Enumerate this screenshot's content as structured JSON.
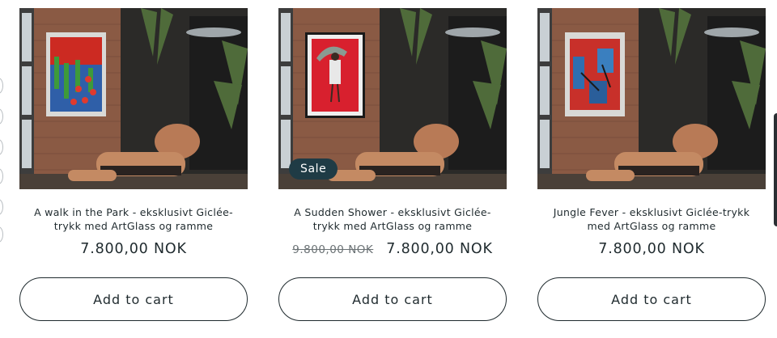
{
  "products": [
    {
      "title": "A walk in the Park - eksklusivt Giclée-trykk med ArtGlass og ramme",
      "price": "7.800,00 NOK",
      "old_price": "",
      "badge": "",
      "button": "Add to cart",
      "artwork": "red-garden-painting"
    },
    {
      "title": "A Sudden Shower - eksklusivt Giclée-trykk med ArtGlass og ramme",
      "price": "7.800,00 NOK",
      "old_price": "9.800,00 NOK",
      "badge": "Sale",
      "button": "Add to cart",
      "artwork": "woman-umbrella-painting"
    },
    {
      "title": "Jungle Fever - eksklusivt Giclée-trykk med ArtGlass og ramme",
      "price": "7.800,00 NOK",
      "old_price": "",
      "badge": "",
      "button": "Add to cart",
      "artwork": "red-blue-abstract-painting"
    }
  ],
  "colors": {
    "badge_bg": "#1f3b45",
    "text": "#1f2a2e",
    "strike": "#6b7275"
  }
}
